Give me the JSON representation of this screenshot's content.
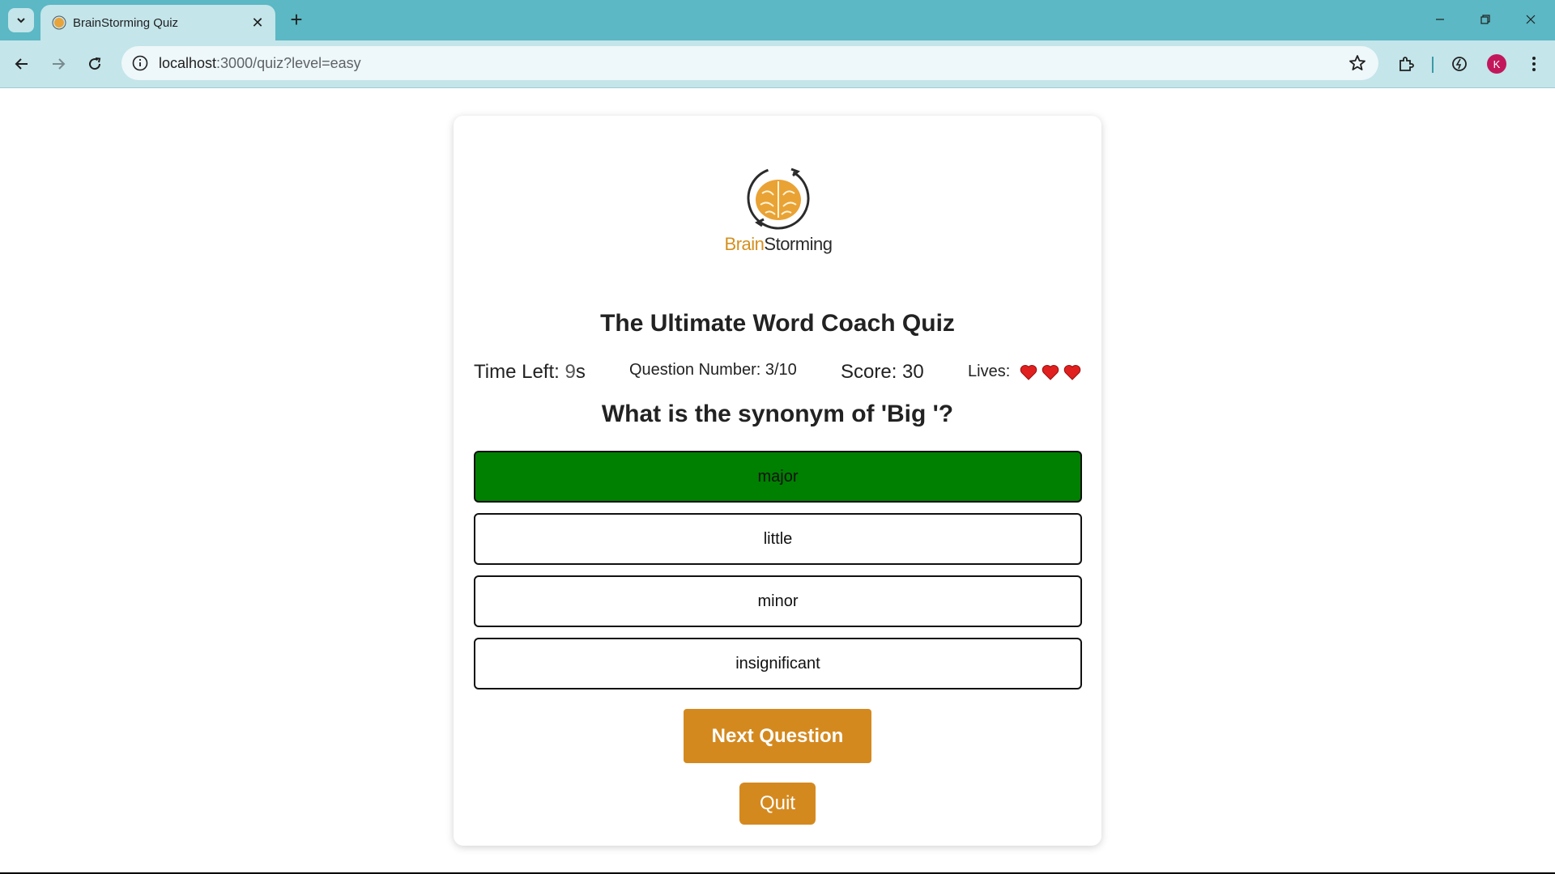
{
  "browser": {
    "tab_title": "BrainStorming Quiz",
    "url_host": "localhost",
    "url_path": ":3000/quiz?level=easy",
    "avatar_letter": "K",
    "accent_color": "#5bb8c4"
  },
  "logo": {
    "word_part1": "Brain",
    "word_part2": "Storming"
  },
  "quiz": {
    "title": "The Ultimate Word Coach Quiz",
    "time_label": "Time Left: ",
    "time_value": "9",
    "time_unit": "s",
    "question_number_text": "Question Number: 3/10",
    "score_text": "Score: 30",
    "lives_label": "Lives:",
    "lives_count": 3,
    "question": "What is the synonym of 'Big '?",
    "options": [
      "major",
      "little",
      "minor",
      "insignificant"
    ],
    "selected_option": "major",
    "selected_color": "#008000",
    "next_label": "Next Question",
    "quit_label": "Quit",
    "button_color": "#d4891f"
  }
}
